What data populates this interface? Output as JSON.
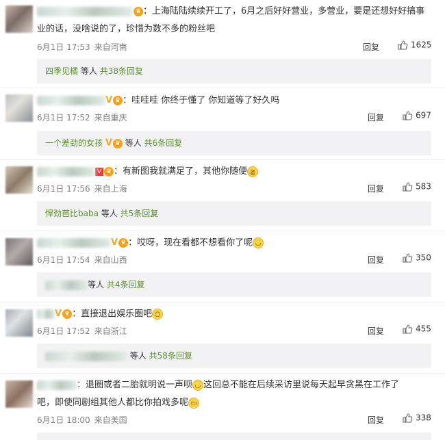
{
  "comments": [
    {
      "text1": "：上海陆陆续续开工了，6月之后好好营业，多营业，要是还想好好搞事",
      "text2": "业的话，没啥说的了，珍惜为数不多的粉丝吧",
      "time": "6月1日 17:53",
      "location": "来自河南",
      "reply_label": "回复",
      "likes": "1625",
      "reply_names": "四季见橘",
      "reply_suffix": "等人",
      "reply_count": "共38条回复"
    },
    {
      "text1": "哇哇哇 你终于懂了 你知道等了好久吗",
      "time": "6月1日 17:52",
      "location": "来自重庆",
      "reply_label": "回复",
      "likes": "697",
      "reply_names": "一个差劲的女孩",
      "reply_suffix": "等人",
      "reply_count": "共6条回复"
    },
    {
      "text1": "有新图我就满足了，其他你随便",
      "time": "6月1日 17:56",
      "location": "来自上海",
      "reply_label": "回复",
      "likes": "583",
      "reply_names": "悍劲芭比baba",
      "reply_suffix": "等人",
      "reply_count": "共5条回复"
    },
    {
      "text1": "：哎呀，现在看都不想看你了呢",
      "time": "6月1日 17:54",
      "location": "来自山西",
      "reply_label": "回复",
      "likes": "350",
      "reply_names": "",
      "reply_suffix": "等人",
      "reply_count": "共4条回复"
    },
    {
      "text1": "：直接退出娱乐圈吧",
      "time": "6月1日 17:52",
      "location": "来自浙江",
      "reply_label": "回复",
      "likes": "455",
      "reply_names": "",
      "reply_suffix": "等人",
      "reply_count": "共58条回复"
    },
    {
      "text1": "：退圈或者二胎就明说一声呗",
      "text1b": "这回总不能在后续采访里说每天起早贪黑在工作了",
      "text2": "吧，即使同剧组其他人都比你拍戏多呢",
      "time": "6月1日 18:00",
      "location": "来自美国",
      "reply_label": "回复",
      "likes": "338"
    }
  ],
  "colors": {
    "reply_bg": "#f2f2f5",
    "link_orange": "#eb7350",
    "link_green": "#5a8f2c",
    "meta_gray": "#808080"
  }
}
